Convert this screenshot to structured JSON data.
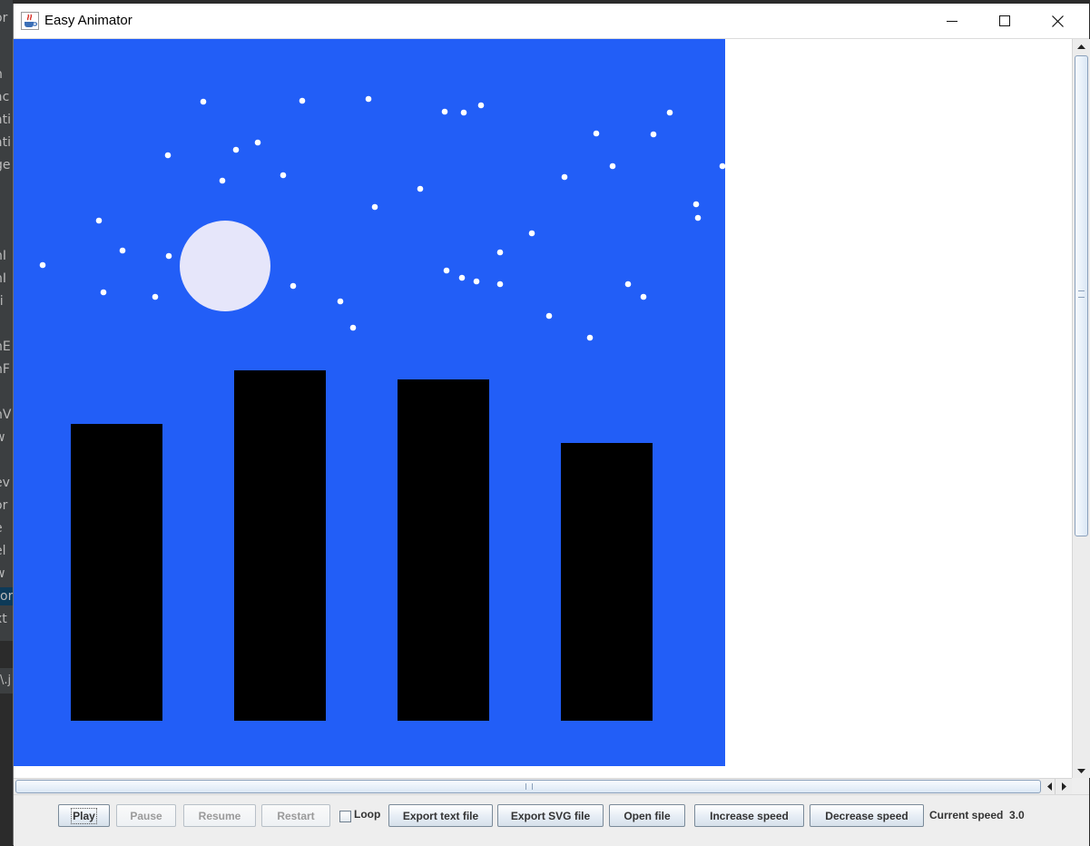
{
  "background_ide": {
    "fragments": [
      "or",
      "n",
      "ac",
      "ati",
      "ati",
      "ge",
      "nI",
      "nI",
      "ri",
      "nE",
      "nF",
      "nV",
      "w",
      "ev",
      "or",
      "e",
      "el",
      "w",
      "or",
      "xt"
    ],
    "bottom_tab": "\\.j"
  },
  "window": {
    "title": "Easy Animator",
    "icon": "java-cup-icon"
  },
  "scene": {
    "background_color": "#225EF7",
    "moon_color": "#E6E6FA",
    "star_color": "#FFFFFF",
    "building_color": "#000000"
  },
  "toolbar": {
    "play_label": "Play",
    "pause_label": "Pause",
    "resume_label": "Resume",
    "restart_label": "Restart",
    "loop_label": "Loop",
    "loop_checked": false,
    "export_text_label": "Export text file",
    "export_svg_label": "Export SVG file",
    "open_file_label": "Open file",
    "increase_speed_label": "Increase speed",
    "decrease_speed_label": "Decrease speed",
    "speed_label": "Current speed",
    "speed_value": "3.0"
  }
}
